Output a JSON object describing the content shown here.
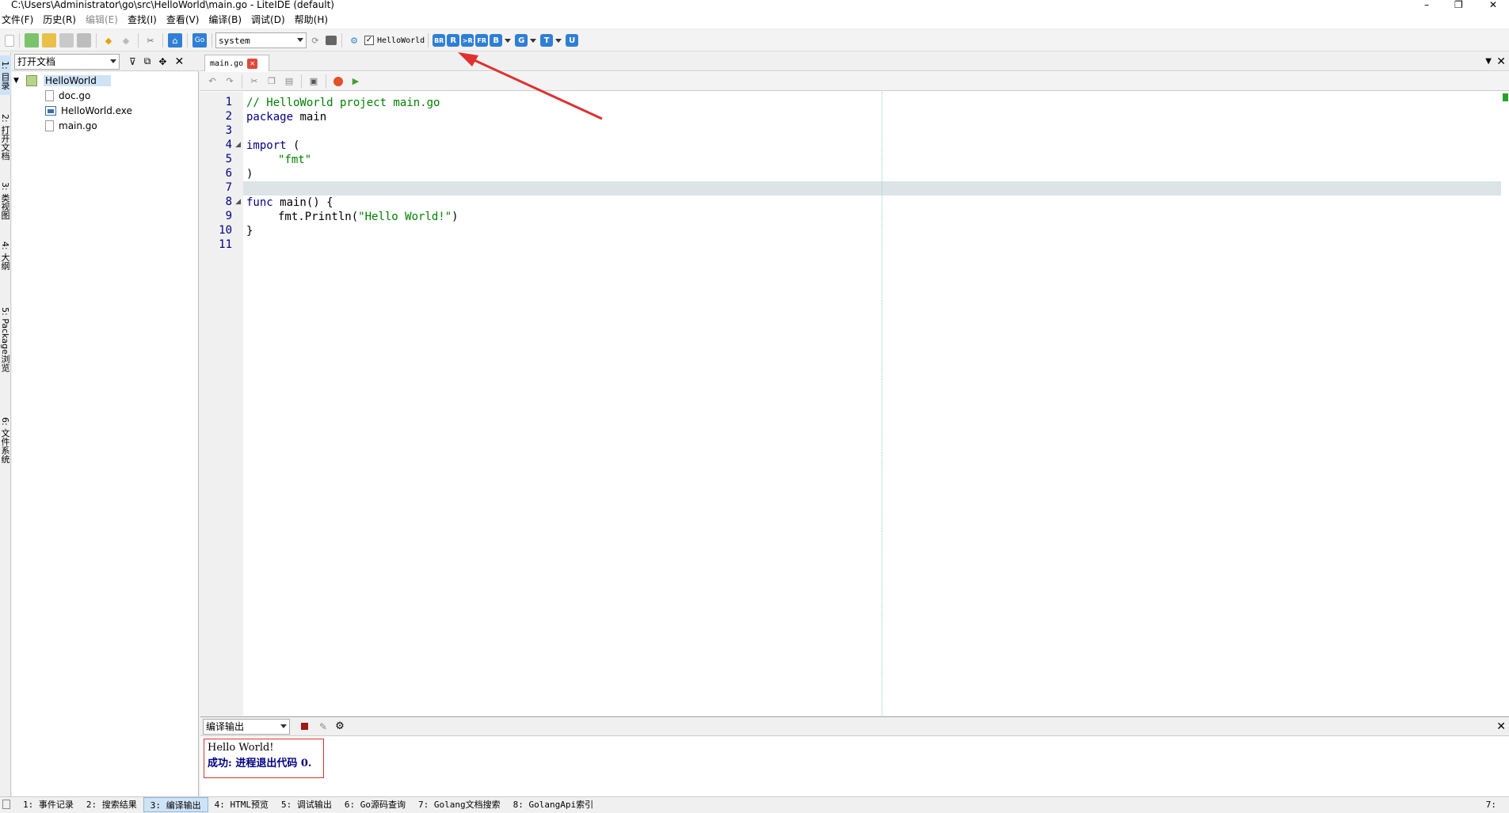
{
  "title": "C:\\Users\\Administrator\\go\\src\\HelloWorld\\main.go - LiteIDE (default)",
  "window_controls": [
    "–",
    "❐",
    "✕"
  ],
  "menu": [
    "文件(F)",
    "历史(R)",
    "编辑(E)",
    "查找(I)",
    "查看(V)",
    "编译(B)",
    "调试(D)",
    "帮助(H)"
  ],
  "toolbar": {
    "env_select": "system",
    "project_check": "HelloWorld",
    "build_buttons": [
      "BR",
      "R",
      ">R",
      "FR",
      "B",
      "G",
      "T",
      "U"
    ]
  },
  "side_tabs": [
    "1: 目录",
    "2: 打开文档",
    "3: 类视图",
    "4: 大纲",
    "5: Package浏览",
    "6: 文件系统"
  ],
  "left_panel": {
    "select": "打开文档",
    "tree": {
      "root": "HelloWorld",
      "children": [
        "doc.go",
        "HelloWorld.exe",
        "main.go"
      ]
    }
  },
  "editor": {
    "tab": "main.go",
    "line_numbers": [
      "1",
      "2",
      "3",
      "4",
      "5",
      "6",
      "7",
      "8",
      "9",
      "10",
      "11"
    ],
    "code": {
      "l1_comment": "// HelloWorld project main.go",
      "l2_kw": "package",
      "l2_rest": " main",
      "l4_kw": "import",
      "l4_rest": " (",
      "l5_str": "\"fmt\"",
      "l6": ")",
      "l8_kw": "func",
      "l8_rest": " main() {",
      "l9_pre": "fmt.Println(",
      "l9_str": "\"Hello World!\"",
      "l9_post": ")",
      "l10": "}"
    }
  },
  "output": {
    "select": "编译输出",
    "line1": "Hello World!",
    "line2": "成功: 进程退出代码 0."
  },
  "status_tabs": [
    "1: 事件记录",
    "2: 搜索结果",
    "3: 编译输出",
    "4: HTML预览",
    "5: 调试输出",
    "6: Go源码查询",
    "7: Golang文档搜索",
    "8: GolangApi索引"
  ],
  "status_right": "7:",
  "colors": {
    "keyword": "#000080",
    "string": "#008000",
    "comment": "#008000",
    "annotation": "#e03030"
  }
}
